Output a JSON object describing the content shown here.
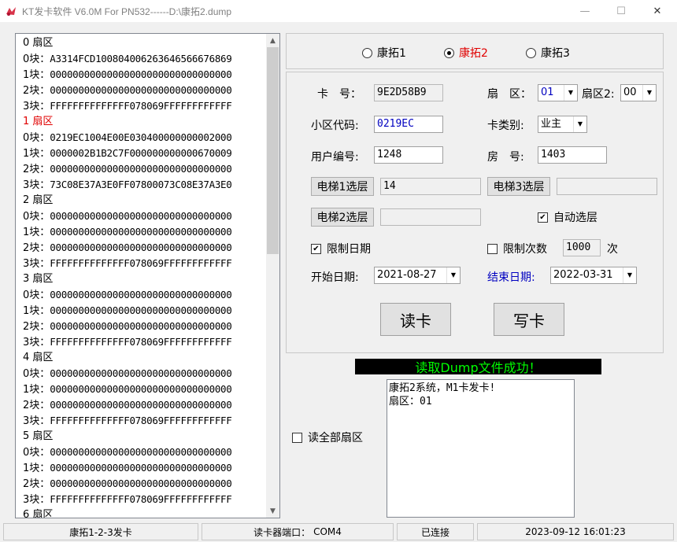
{
  "window": {
    "title": "KT发卡软件 V6.0M For PN532------D:\\康拓2.dump",
    "minimize": "—",
    "maximize": "☐",
    "close": "✕"
  },
  "dump": {
    "lines": [
      {
        "label": "0 扇区",
        "text": "",
        "red": false
      },
      {
        "label": "0块：",
        "text": "A3314FCD1008040062636465666768​69",
        "red": false
      },
      {
        "label": "1块：",
        "text": "00000000000000000000000000000000",
        "red": false
      },
      {
        "label": "2块：",
        "text": "00000000000000000000000000000000",
        "red": false
      },
      {
        "label": "3块：",
        "text": "FFFFFFFFFFFFFF078069FFFFFFFFFFFF",
        "red": false
      },
      {
        "label": "1 扇区",
        "text": "",
        "red": true
      },
      {
        "label": "0块：",
        "text": "0219EC1004E00E030400000000002000",
        "red": false
      },
      {
        "label": "1块：",
        "text": "0000002B1B2C7F000000000000670009",
        "red": false
      },
      {
        "label": "2块：",
        "text": "00000000000000000000000000000000",
        "red": false
      },
      {
        "label": "3块：",
        "text": "73C08E37A3E0FF07800073C08E37A3E0",
        "red": false
      },
      {
        "label": "2 扇区",
        "text": "",
        "red": false
      },
      {
        "label": "0块：",
        "text": "00000000000000000000000000000000",
        "red": false
      },
      {
        "label": "1块：",
        "text": "00000000000000000000000000000000",
        "red": false
      },
      {
        "label": "2块：",
        "text": "00000000000000000000000000000000",
        "red": false
      },
      {
        "label": "3块：",
        "text": "FFFFFFFFFFFFFF078069FFFFFFFFFFFF",
        "red": false
      },
      {
        "label": "3 扇区",
        "text": "",
        "red": false
      },
      {
        "label": "0块：",
        "text": "00000000000000000000000000000000",
        "red": false
      },
      {
        "label": "1块：",
        "text": "00000000000000000000000000000000",
        "red": false
      },
      {
        "label": "2块：",
        "text": "00000000000000000000000000000000",
        "red": false
      },
      {
        "label": "3块：",
        "text": "FFFFFFFFFFFFFF078069FFFFFFFFFFFF",
        "red": false
      },
      {
        "label": "4 扇区",
        "text": "",
        "red": false
      },
      {
        "label": "0块：",
        "text": "00000000000000000000000000000000",
        "red": false
      },
      {
        "label": "1块：",
        "text": "00000000000000000000000000000000",
        "red": false
      },
      {
        "label": "2块：",
        "text": "00000000000000000000000000000000",
        "red": false
      },
      {
        "label": "3块：",
        "text": "FFFFFFFFFFFFFF078069FFFFFFFFFFFF",
        "red": false
      },
      {
        "label": "5 扇区",
        "text": "",
        "red": false
      },
      {
        "label": "0块：",
        "text": "00000000000000000000000000000000",
        "red": false
      },
      {
        "label": "1块：",
        "text": "00000000000000000000000000000000",
        "red": false
      },
      {
        "label": "2块：",
        "text": "00000000000000000000000000000000",
        "red": false
      },
      {
        "label": "3块：",
        "text": "FFFFFFFFFFFFFF078069FFFFFFFFFFFF",
        "red": false
      },
      {
        "label": "6 扇区",
        "text": "",
        "red": false
      }
    ]
  },
  "modes": [
    {
      "label": "康拓1",
      "selected": false,
      "color": "#000000"
    },
    {
      "label": "康拓2",
      "selected": true,
      "color": "#e00000"
    },
    {
      "label": "康拓3",
      "selected": false,
      "color": "#000000"
    }
  ],
  "form": {
    "card_no_label": "卡　号：",
    "card_no": "9E2D58B9",
    "sector_label": "扇　区：",
    "sector": "01",
    "sector2_label": "扇区2:",
    "sector2": "00",
    "area_code_label": "小区代码:",
    "area_code": "0219EC",
    "card_type_label": "卡类别:",
    "card_type": "业主",
    "user_no_label": "用户编号:",
    "user_no": "1248",
    "room_label": "房　号:",
    "room": "1403",
    "elevator1_btn": "电梯1选层",
    "elevator1_val": "14",
    "elevator3_btn": "电梯3选层",
    "elevator3_val": "",
    "elevator2_btn": "电梯2选层",
    "elevator2_val": "",
    "auto_floor_label": "自动选层",
    "auto_floor_checked": true,
    "limit_date_label": "限制日期",
    "limit_date_checked": true,
    "limit_count_label": "限制次数",
    "limit_count_checked": false,
    "limit_count": "1000",
    "count_unit": "次",
    "start_date_label": "开始日期:",
    "start_date": "2021-08-27",
    "end_date_label": "结束日期:",
    "end_date": "2022-03-31",
    "read_btn": "读卡",
    "write_btn": "写卡"
  },
  "banner": "读取Dump文件成功！",
  "read_all_label": "读全部扇区",
  "read_all_checked": false,
  "log": "康拓2系统，M1卡发卡!\n扇区：01",
  "status": {
    "mode": "康拓1-2-3发卡",
    "port_label": "读卡器端口：",
    "port": "COM4",
    "connection": "已连接",
    "datetime": "2023-09-12 16:01:23"
  },
  "colors": {
    "red_text": "#e00000",
    "blue_text": "#0000c0",
    "banner_bg": "#000000",
    "banner_text": "#00ff00"
  }
}
